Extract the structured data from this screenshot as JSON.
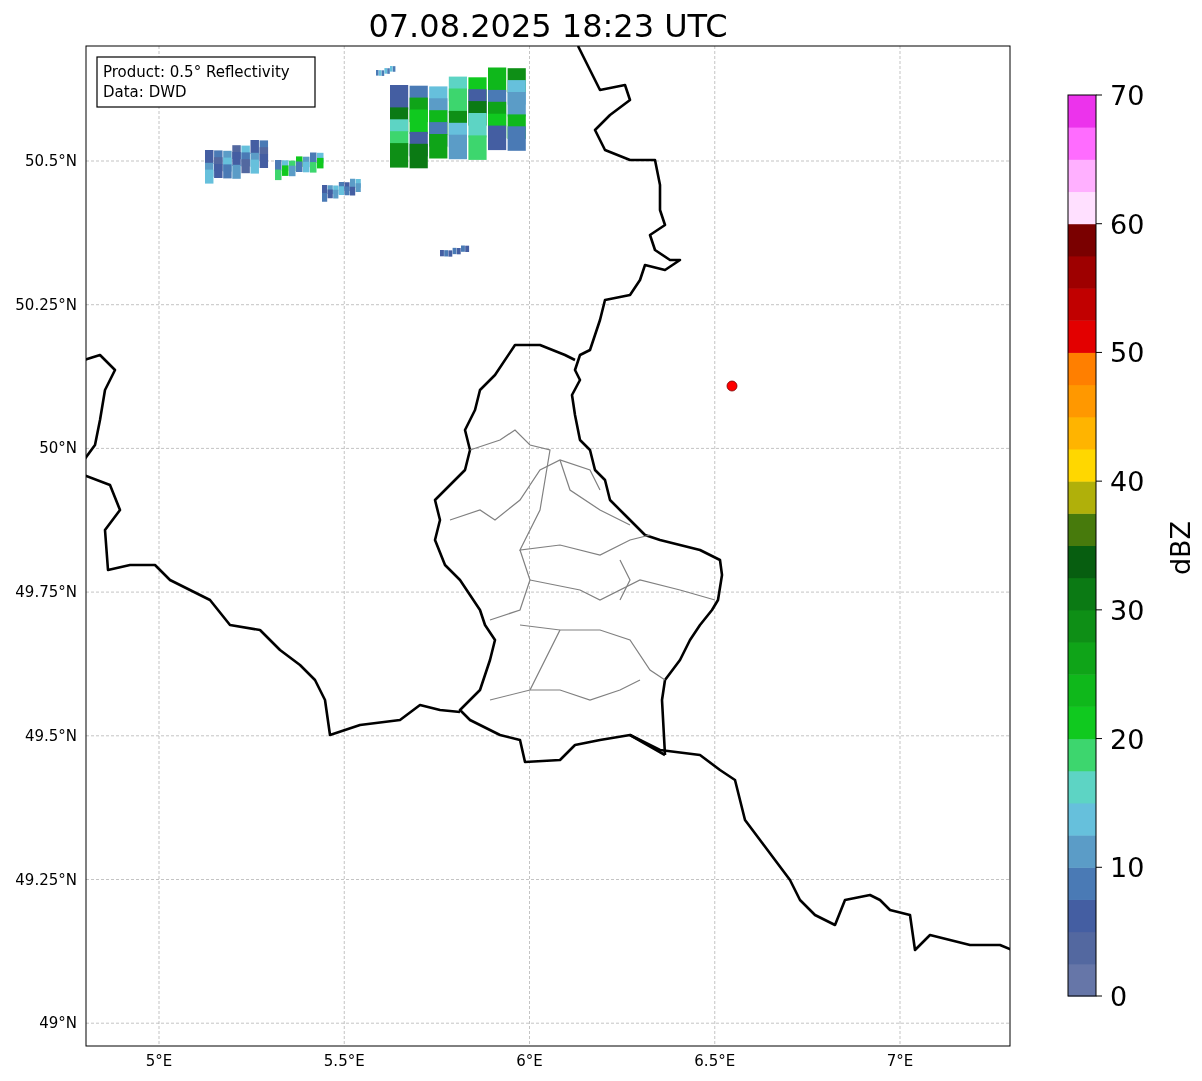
{
  "title": "07.08.2025 18:23 UTC",
  "info_box": [
    "Product: 0.5° Reflectivity",
    "Data: DWD"
  ],
  "map": {
    "yticks": [
      "50.5°N",
      "50.25°N",
      "50°N",
      "49.75°N",
      "49.5°N",
      "49.25°N",
      "49°N"
    ],
    "xticks": [
      "5°E",
      "5.5°E",
      "6°E",
      "6.5°E",
      "7°E"
    ]
  },
  "colorbar": {
    "label": "dBZ",
    "ticks": [
      "70",
      "60",
      "50",
      "40",
      "30",
      "20",
      "10",
      "0"
    ],
    "bands": [
      {
        "color": "#6676a8"
      },
      {
        "color": "#5368a0"
      },
      {
        "color": "#445ea2"
      },
      {
        "color": "#4a7ab5"
      },
      {
        "color": "#5b9cc7"
      },
      {
        "color": "#66c0dc"
      },
      {
        "color": "#5dd4c4"
      },
      {
        "color": "#3dd66e"
      },
      {
        "color": "#10c91f"
      },
      {
        "color": "#0fb81b"
      },
      {
        "color": "#0fa418"
      },
      {
        "color": "#0e8f16"
      },
      {
        "color": "#0b7a14"
      },
      {
        "color": "#075e10"
      },
      {
        "color": "#477a0c"
      },
      {
        "color": "#b0b00a"
      },
      {
        "color": "#ffd700"
      },
      {
        "color": "#ffb400"
      },
      {
        "color": "#ff9800"
      },
      {
        "color": "#ff7f00"
      },
      {
        "color": "#e30000"
      },
      {
        "color": "#c10000"
      },
      {
        "color": "#9e0000"
      },
      {
        "color": "#7a0000"
      },
      {
        "color": "#ffe0ff"
      },
      {
        "color": "#ffb0ff"
      },
      {
        "color": "#ff6cff"
      },
      {
        "color": "#ec33ec"
      }
    ]
  }
}
